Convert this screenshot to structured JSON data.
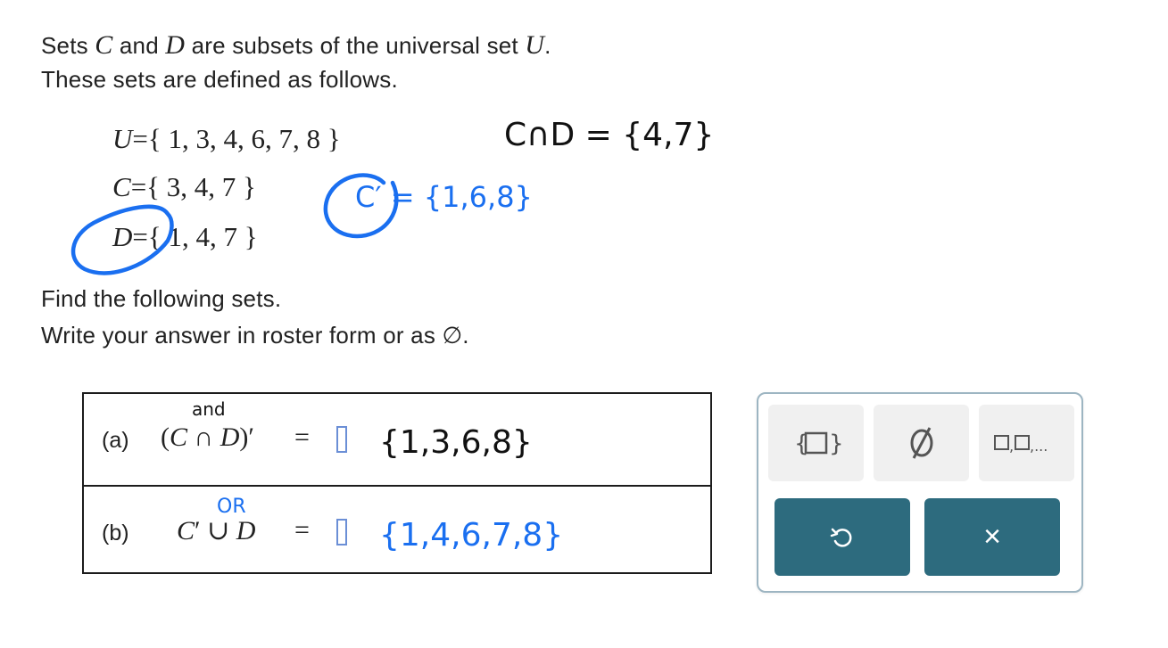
{
  "prompt": {
    "line1": {
      "a": "Sets ",
      "C": "C",
      "b": " and ",
      "D": "D",
      "c": " are subsets of the universal set ",
      "U": "U",
      "d": "."
    },
    "line2": "These sets are defined as follows.",
    "line3": "Find the following sets.",
    "line4": "Write your answer in roster form or as ∅."
  },
  "sets": [
    {
      "name": "U",
      "eq": "=",
      "value": "{ 1, 3, 4, 6, 7, 8 }"
    },
    {
      "name": "C",
      "eq": "=",
      "value": "{ 3, 4, 7 }"
    },
    {
      "name": "D",
      "eq": "=",
      "value": "{ 1, 4, 7 }"
    }
  ],
  "annotations": {
    "intersection": "C∩D = {4,7}",
    "complement_c": "C′ = {1,6,8}",
    "word_and": "and",
    "word_or": "OR",
    "answer_a": "{1,3,6,8}",
    "answer_b": "{1,4,6,7,8}",
    "ink_color": "#1a6ff0"
  },
  "questions": [
    {
      "label": "(a)",
      "expr_open": "(",
      "expr_C": "C",
      "expr_op": " ∩ ",
      "expr_D": "D",
      "expr_close": ")′",
      "eq": "="
    },
    {
      "label": "(b)",
      "expr_C": "C",
      "expr_prime": "′",
      "expr_op": " ∪ ",
      "expr_D": "D",
      "eq": "="
    }
  ],
  "keypad": {
    "keys": [
      {
        "name": "set-braces",
        "glyph": "{□}"
      },
      {
        "name": "empty-set",
        "glyph": "∅"
      },
      {
        "name": "list",
        "glyph": "□,□,..."
      }
    ],
    "undo_icon": "undo-icon",
    "clear_label": "×",
    "accent": "#2d6b7e"
  }
}
